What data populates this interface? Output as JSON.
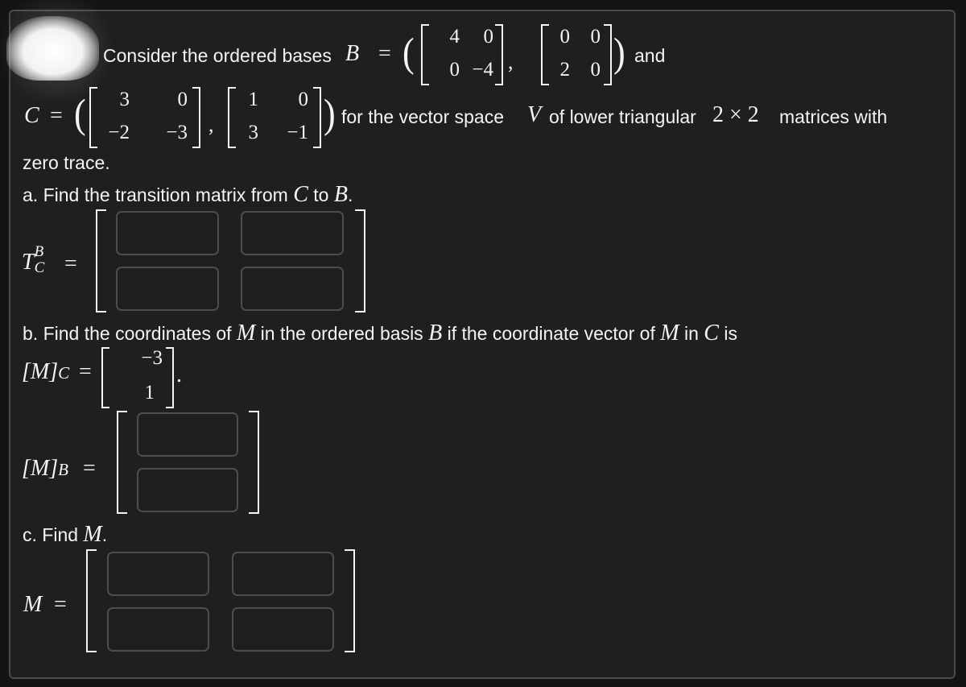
{
  "problem": {
    "intro": "Consider the ordered bases",
    "B_label": "B",
    "equals": "=",
    "and": "and",
    "C_label": "C",
    "for_text": "for the vector space",
    "V_label": "V",
    "of_text": "of lower triangular",
    "dims": "2 × 2",
    "with_text": "matrices with",
    "zero_trace": "zero trace.",
    "basis_B": [
      [
        [
          "4",
          "0"
        ],
        [
          "0",
          "−4"
        ]
      ],
      [
        [
          "0",
          "0"
        ],
        [
          "2",
          "0"
        ]
      ]
    ],
    "basis_C": [
      [
        [
          "3",
          "0"
        ],
        [
          "−2",
          "−3"
        ]
      ],
      [
        [
          "1",
          "0"
        ],
        [
          "3",
          "−1"
        ]
      ]
    ]
  },
  "part_a": {
    "prefix": "a. Find the transition matrix from",
    "from": "C",
    "to_word": "to",
    "to": "B",
    "period": ".",
    "lhs_T": "T",
    "lhs_sup": "B",
    "lhs_sub": "C",
    "inputs": [
      [
        "",
        ""
      ],
      [
        "",
        ""
      ]
    ]
  },
  "part_b": {
    "prefix": "b. Find the coordinates of",
    "M": "M",
    "mid": "in the ordered basis",
    "B": "B",
    "if_text": "if the coordinate vector of",
    "in_text": "in",
    "C": "C",
    "is_text": "is",
    "MC_lhs": "[M]",
    "MC_sub": "C",
    "MC_vector": [
      "−3",
      "1"
    ],
    "MB_lhs": "[M]",
    "MB_sub": "B",
    "inputs": [
      "",
      ""
    ]
  },
  "part_c": {
    "prefix": "c. Find",
    "M": "M",
    "period": ".",
    "lhs": "M",
    "inputs": [
      [
        "",
        ""
      ],
      [
        "",
        ""
      ]
    ]
  }
}
